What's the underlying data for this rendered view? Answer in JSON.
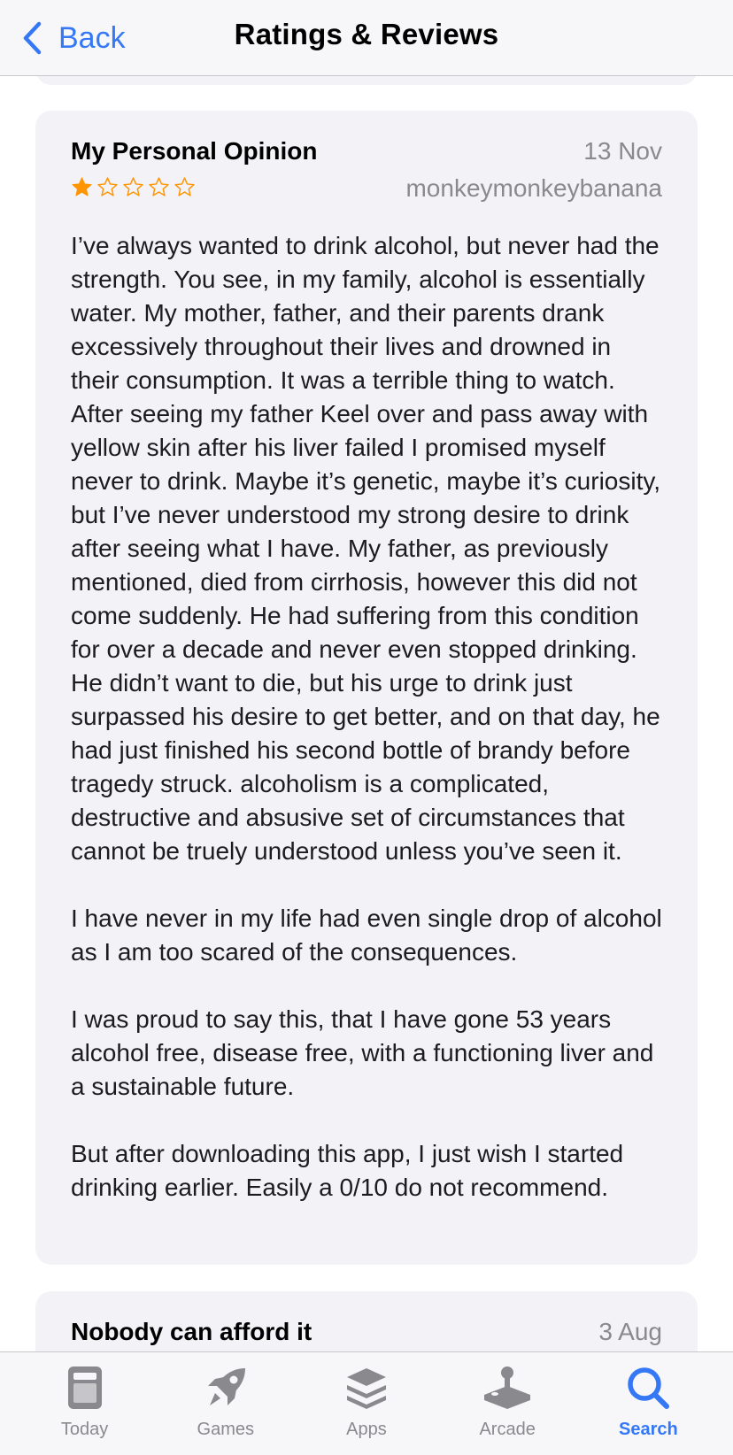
{
  "colors": {
    "accent": "#3478f6",
    "star": "#ff9500",
    "card_bg": "#f2f2f7",
    "secondary_text": "#8a8a8e",
    "tab_inactive": "#8a8a8e"
  },
  "navbar": {
    "back_label": "Back",
    "back_icon": "chevron-left-icon",
    "title": "Ratings & Reviews"
  },
  "reviews": [
    {
      "title": "My Personal Opinion",
      "date": "13 Nov",
      "author": "monkeymonkeybanana",
      "rating": 1,
      "max_rating": 5,
      "paragraphs": [
        "I’ve always wanted to drink alcohol, but never had the strength. You see, in my family, alcohol is essentially water. My mother, father, and their parents drank excessively throughout their lives and drowned in their consumption. It was a terrible thing to watch. After seeing my father Keel over and pass away with yellow skin after his liver failed I promised myself never to drink. Maybe it’s genetic, maybe it’s curiosity, but I’ve never understood my strong desire to drink after seeing what I have. My father, as previously mentioned, died from cirrhosis, however this did not come suddenly. He had suffering from this condition for over a decade and never even stopped drinking. He didn’t want to die, but his urge to drink just surpassed his desire to get better, and on that day, he had just finished his second bottle of brandy before tragedy struck. alcoholism is a complicated, destructive and absusive set of circumstances that cannot be truely understood unless you’ve seen it.",
        "I have never in my life had even single drop of alcohol as I am too scared of the consequences.",
        "I was proud to say this, that I have gone 53 years alcohol free, disease free, with a functioning liver and a sustainable future.",
        "But after downloading this app, I just wish I started drinking earlier. Easily a 0/10 do not recommend."
      ]
    },
    {
      "title": "Nobody can afford it",
      "date": "3 Aug"
    }
  ],
  "tabbar": {
    "items": [
      {
        "label": "Today",
        "icon": "today-icon",
        "active": false
      },
      {
        "label": "Games",
        "icon": "rocket-icon",
        "active": false
      },
      {
        "label": "Apps",
        "icon": "apps-stack-icon",
        "active": false
      },
      {
        "label": "Arcade",
        "icon": "joystick-icon",
        "active": false
      },
      {
        "label": "Search",
        "icon": "search-icon",
        "active": true
      }
    ]
  }
}
